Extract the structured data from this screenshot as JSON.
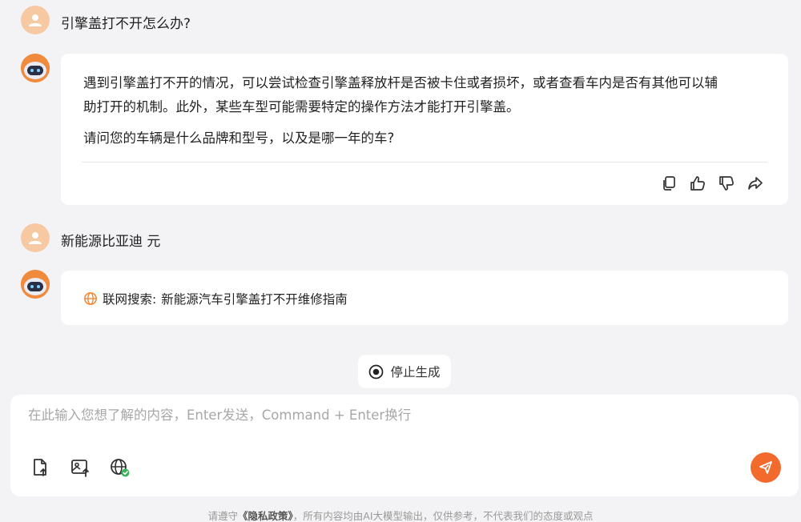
{
  "messages": {
    "user1": "引擎盖打不开怎么办?",
    "bot1": {
      "para1_line1": "遇到引擎盖打不开的情况，可以尝试检查引擎盖释放杆是否被卡住或者损坏，或者查看车内是否有其他可以辅",
      "para1_line2": "助打开的机制。此外，某些车型可能需要特定的操作方法才能打开引擎盖。",
      "para2": "请问您的车辆是什么品牌和型号，以及是哪一年的车?"
    },
    "user2": "新能源比亚迪 元",
    "bot2": {
      "search_label": "联网搜索:",
      "search_query": "新能源汽车引擎盖打不开维修指南"
    }
  },
  "stop_button": "停止生成",
  "input": {
    "placeholder": "在此输入您想了解的内容，Enter发送，Command + Enter换行",
    "value": ""
  },
  "footer": {
    "prefix": "请遵守",
    "policy": "《隐私政策》",
    "suffix": "，所有内容均由AI大模型输出，仅供参考，不代表我们的态度或观点"
  },
  "colors": {
    "accent": "#f26a2c",
    "user_avatar": "#f7c9a3",
    "background": "#f3f3f5"
  },
  "icons": [
    "user-icon",
    "bot-icon",
    "copy-icon",
    "thumbs-up-icon",
    "thumbs-down-icon",
    "share-icon",
    "globe-icon",
    "stop-icon",
    "file-upload-icon",
    "image-upload-icon",
    "web-search-icon",
    "send-icon"
  ]
}
